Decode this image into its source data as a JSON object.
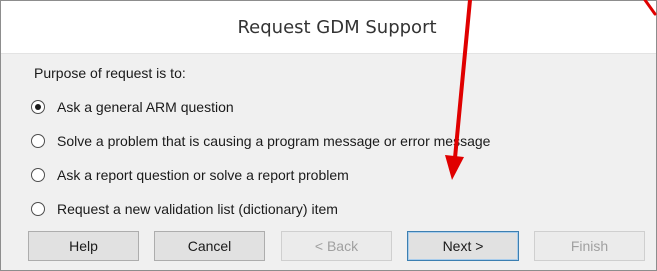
{
  "dialog": {
    "title": "Request GDM Support"
  },
  "purpose": {
    "label": "Purpose of request is to:",
    "options": [
      {
        "label": "Ask a general ARM question",
        "selected": true
      },
      {
        "label": "Solve a problem that is causing a program message or error message",
        "selected": false
      },
      {
        "label": "Ask a report question or solve a report problem",
        "selected": false
      },
      {
        "label": "Request a new validation list (dictionary) item",
        "selected": false
      }
    ]
  },
  "buttons": {
    "help": "Help",
    "cancel": "Cancel",
    "back": "< Back",
    "next": "Next >",
    "finish": "Finish"
  },
  "annotation": {
    "arrow_color": "#e00000"
  }
}
